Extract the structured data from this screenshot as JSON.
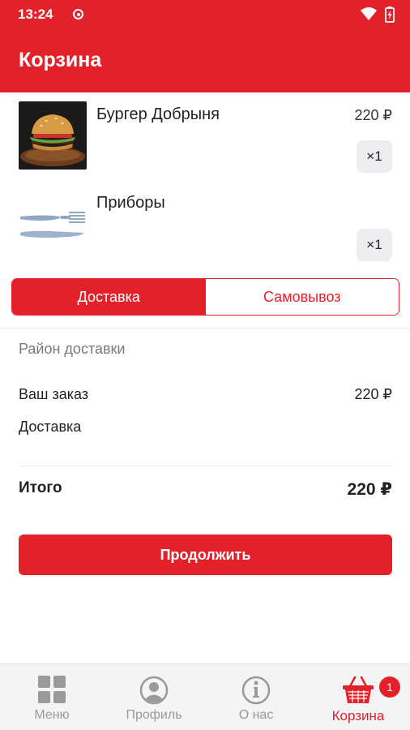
{
  "status_bar": {
    "time": "13:24"
  },
  "app_bar": {
    "title": "Корзина"
  },
  "cart": {
    "items": [
      {
        "name": "Бургер Добрыня",
        "price": "220 ₽",
        "qty": "×1",
        "image_icon": "burger-image"
      },
      {
        "name": "Приборы",
        "price": "",
        "qty": "×1",
        "image_icon": "cutlery-image"
      }
    ]
  },
  "delivery_toggle": {
    "options": [
      {
        "label": "Доставка",
        "selected": true
      },
      {
        "label": "Самовывоз",
        "selected": false
      }
    ]
  },
  "summary": {
    "district_placeholder": "Район доставки",
    "order_label": "Ваш заказ",
    "order_value": "220 ₽",
    "delivery_label": "Доставка",
    "delivery_value": "",
    "total_label": "Итого",
    "total_value": "220 ₽"
  },
  "continue_button": {
    "label": "Продолжить"
  },
  "bottom_nav": {
    "items": [
      {
        "label": "Меню",
        "icon": "grid-icon"
      },
      {
        "label": "Профиль",
        "icon": "profile-icon"
      },
      {
        "label": "О нас",
        "icon": "info-icon"
      },
      {
        "label": "Корзина",
        "icon": "basket-icon",
        "active": true
      }
    ],
    "cart_badge": "1"
  },
  "colors": {
    "accent": "#e3212b",
    "inactive": "#9a9a9a",
    "qty_bg": "#ececf1"
  }
}
